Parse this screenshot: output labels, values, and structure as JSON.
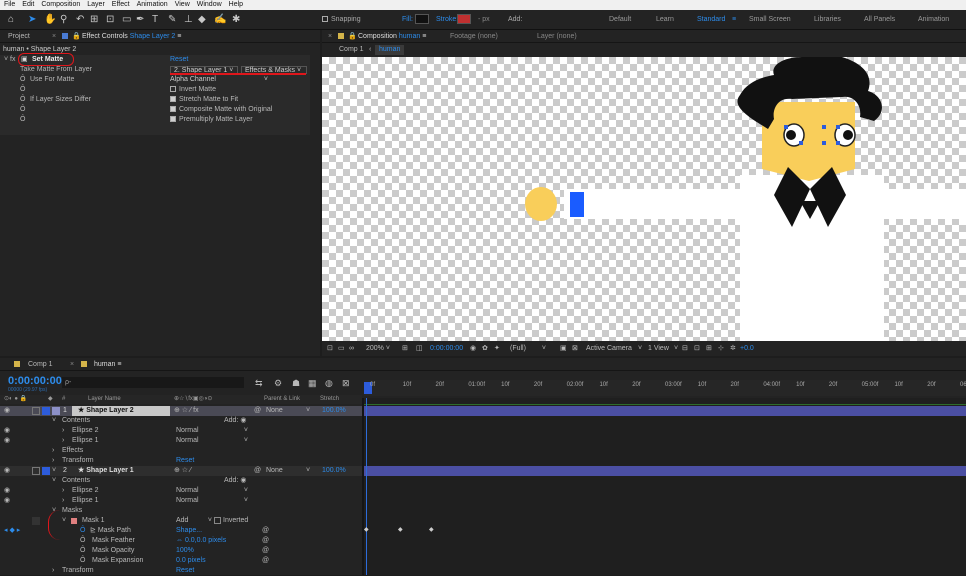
{
  "menu": [
    "File",
    "Edit",
    "Composition",
    "Layer",
    "Effect",
    "Animation",
    "View",
    "Window",
    "Help"
  ],
  "toolbar": {
    "snapping": "Snapping",
    "fill": "Fill:",
    "stroke": "Stroke:",
    "px": "- px",
    "add": "Add:",
    "workspaces": [
      "Default",
      "Learn",
      "Standard",
      "Small Screen",
      "Libraries",
      "All Panels",
      "Animation"
    ],
    "active_workspace": "Standard"
  },
  "effect_panel": {
    "tab_project": "Project",
    "tab_effect_prefix": "Effect Controls",
    "tab_effect_layer": "Shape Layer 2",
    "breadcrumb": "human • Shape Layer 2",
    "fx_name": "Set Matte",
    "reset": "Reset",
    "props": {
      "take_matte": "Take Matte From Layer",
      "take_matte_value": "2. Shape Layer 1",
      "take_matte_value2": "Effects & Masks",
      "use_for_matte": "Use For Matte",
      "use_for_matte_value": "Alpha Channel",
      "invert": "Invert Matte",
      "if_layer_sizes": "If Layer Sizes Differ",
      "stretch": "Stretch Matte to Fit",
      "composite": "Composite Matte with Original",
      "premultiply": "Premultiply Matte Layer"
    }
  },
  "comp_panel": {
    "tab_prefix": "Composition",
    "tab_name": "human",
    "footage": "Footage (none)",
    "layer": "Layer (none)",
    "crumb1": "Comp 1",
    "crumb2": "human",
    "zoom": "200%",
    "timecode": "0:00:00:00",
    "resolution": "(Full)",
    "camera": "Active Camera",
    "views": "1 View",
    "exposure": "+0.0"
  },
  "timeline": {
    "tab1": "Comp 1",
    "tab2": "human",
    "timecode": "0:00:00:00",
    "fps": "00000 (29.97 fps)",
    "search_placeholder": "ρ-",
    "headers": {
      "layer_name": "Layer Name",
      "parent": "Parent & Link",
      "stretch": "Stretch"
    },
    "ruler": [
      "0f",
      "10f",
      "20f",
      "01:00f",
      "10f",
      "20f",
      "02:00f",
      "10f",
      "20f",
      "03:00f",
      "10f",
      "20f",
      "04:00f",
      "10f",
      "20f",
      "05:00f",
      "10f",
      "20f",
      "06:00"
    ],
    "rows": [
      {
        "num": "1",
        "name": "Shape Layer 2",
        "parent": "None",
        "stretch": "100.0%"
      },
      {
        "name": "Contents",
        "add": "Add:"
      },
      {
        "name": "Ellipse 2",
        "mode": "Normal"
      },
      {
        "name": "Ellipse 1",
        "mode": "Normal"
      },
      {
        "name": "Effects"
      },
      {
        "name": "Transform",
        "value": "Reset"
      },
      {
        "num": "2",
        "name": "Shape Layer 1",
        "parent": "None",
        "stretch": "100.0%"
      },
      {
        "name": "Contents",
        "add": "Add:"
      },
      {
        "name": "Ellipse 2",
        "mode": "Normal"
      },
      {
        "name": "Ellipse 1",
        "mode": "Normal"
      },
      {
        "name": "Masks"
      },
      {
        "name": "Mask 1",
        "mode": "Add",
        "inverted": "Inverted"
      },
      {
        "name": "Mask Path",
        "value": "Shape..."
      },
      {
        "name": "Mask Feather",
        "value": "0.0,0.0 pixels"
      },
      {
        "name": "Mask Opacity",
        "value": "100%"
      },
      {
        "name": "Mask Expansion",
        "value": "0.0 pixels"
      },
      {
        "name": "Transform",
        "value": "Reset"
      }
    ]
  },
  "colors": {
    "accent": "#2d8ceb",
    "layer_bar": "#4b4fa3",
    "face": "#f9ce5a",
    "hand_blue": "#1a5cff",
    "annotation": "#e0161b"
  }
}
